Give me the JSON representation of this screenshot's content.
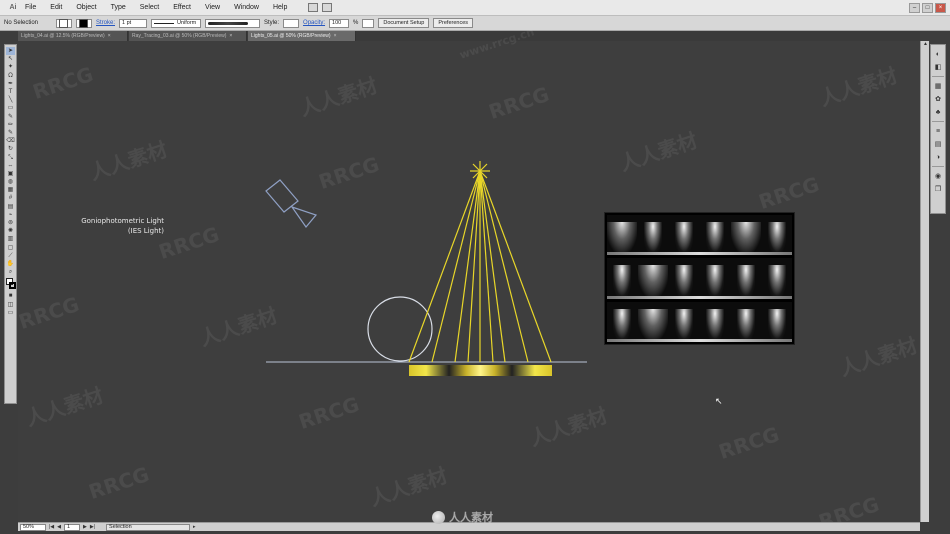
{
  "menubar": {
    "app_logo": "Ai",
    "items": [
      "File",
      "Edit",
      "Object",
      "Type",
      "Select",
      "Effect",
      "View",
      "Window",
      "Help"
    ],
    "window_controls": [
      "–",
      "□",
      "×"
    ]
  },
  "controlbar": {
    "selection_label": "No Selection",
    "stroke_label": "Stroke:",
    "stroke_weight": "1 pt",
    "stroke_profile": "Uniform",
    "style_label": "Style:",
    "opacity_label": "Opacity:",
    "opacity_value": "100",
    "opacity_unit": "%",
    "document_setup": "Document Setup",
    "preferences": "Preferences"
  },
  "tabs": [
    {
      "label": "Lights_04.ai @ 12.5% (RGB/Preview)",
      "active": false
    },
    {
      "label": "Ray_Tracing_03.ai @ 50% (RGB/Preview)",
      "active": false
    },
    {
      "label": "Lights_05.ai @ 50% (RGB/Preview)",
      "active": true
    }
  ],
  "canvas": {
    "label_line1": "Goniophotometric Light",
    "label_line2": "(IES Light)"
  },
  "watermarks": {
    "rrcg": "RRCG",
    "cn": "人人素材",
    "url": "www.rrcg.cn"
  },
  "statusbar": {
    "zoom": "50%",
    "page": "1",
    "tool": "Selection"
  },
  "bottom_logo": "人人素材",
  "colors": {
    "canvas_bg": "#3e3e3e",
    "light_rays": "#e8d629",
    "outline": "#b9c4d6"
  }
}
